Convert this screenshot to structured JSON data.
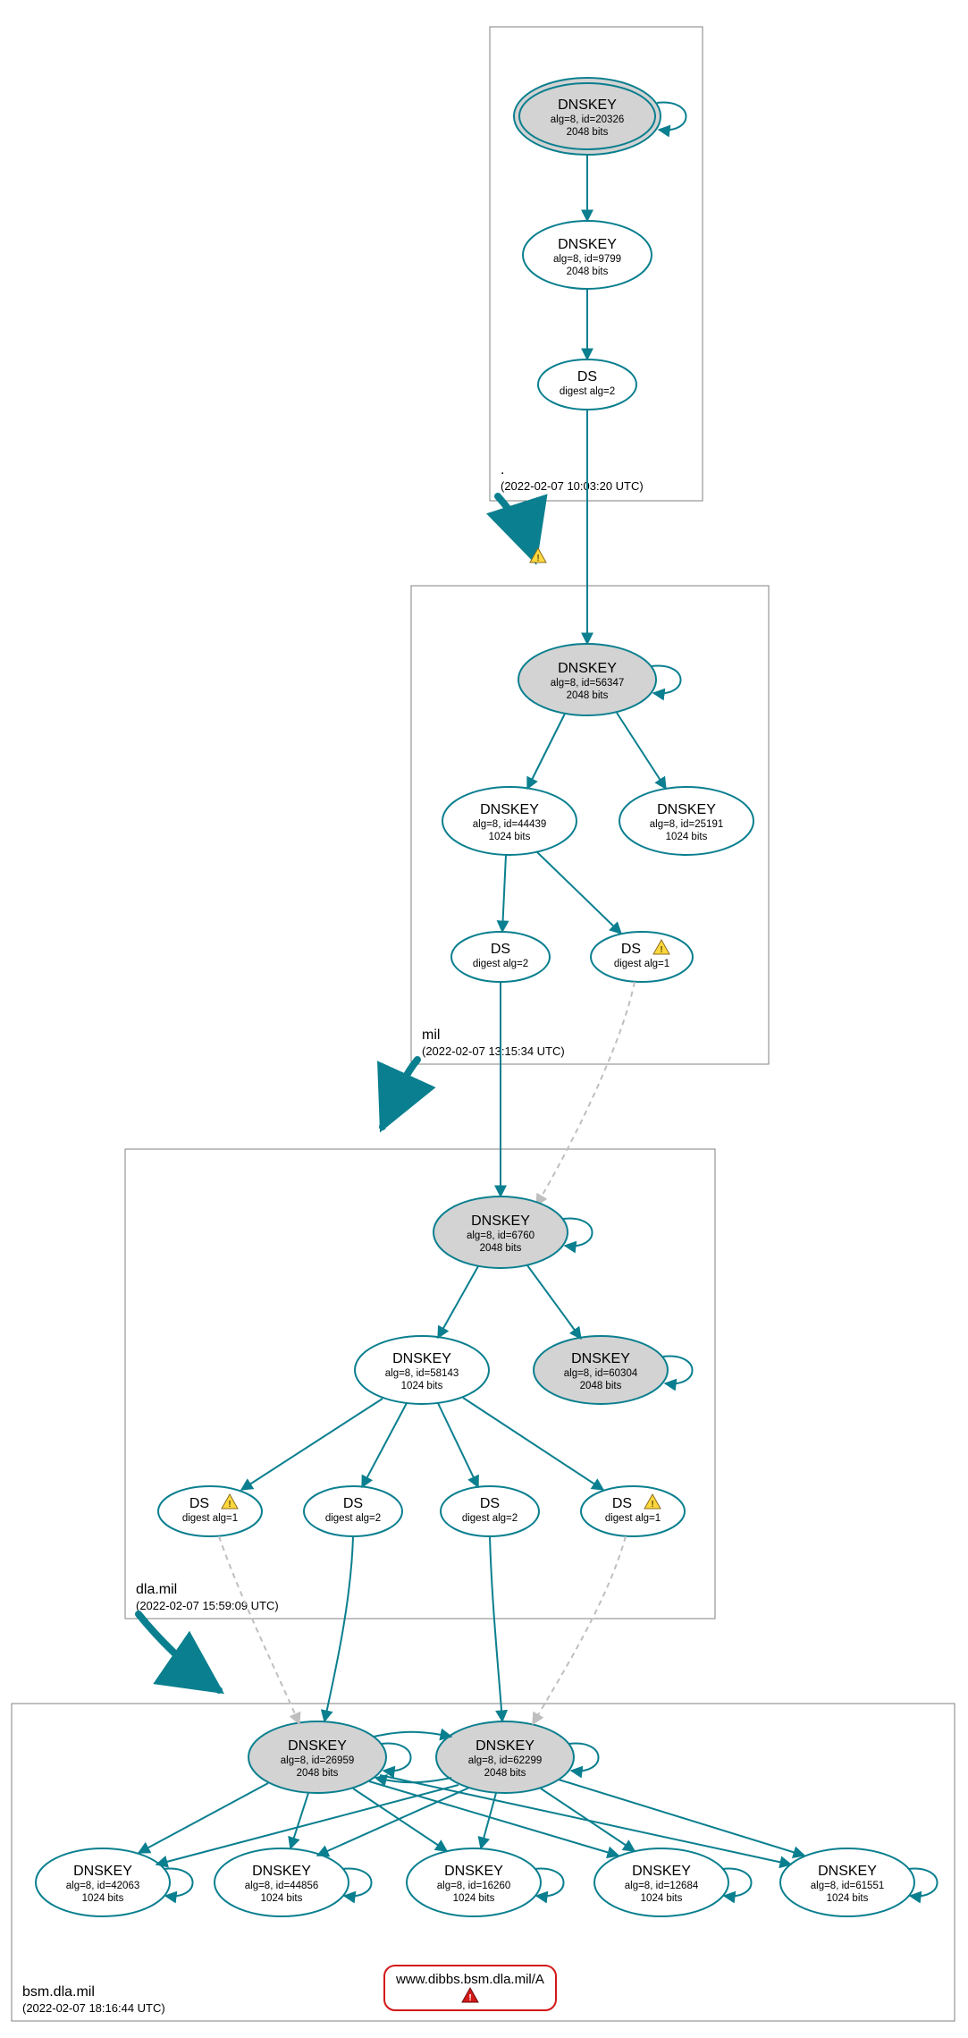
{
  "chart_data": {
    "type": "graph",
    "zones": [
      {
        "id": "root",
        "name": ".",
        "timestamp": "(2022-02-07 10:03:20 UTC)"
      },
      {
        "id": "mil",
        "name": "mil",
        "timestamp": "(2022-02-07 13:15:34 UTC)"
      },
      {
        "id": "dla",
        "name": "dla.mil",
        "timestamp": "(2022-02-07 15:59:09 UTC)"
      },
      {
        "id": "bsm",
        "name": "bsm.dla.mil",
        "timestamp": "(2022-02-07 18:16:44 UTC)"
      }
    ],
    "nodes": {
      "root_ksk": {
        "title": "DNSKEY",
        "line2": "alg=8, id=20326",
        "line3": "2048 bits"
      },
      "root_zsk": {
        "title": "DNSKEY",
        "line2": "alg=8, id=9799",
        "line3": "2048 bits"
      },
      "root_ds": {
        "title": "DS",
        "line2": "digest alg=2"
      },
      "mil_ksk": {
        "title": "DNSKEY",
        "line2": "alg=8, id=56347",
        "line3": "2048 bits"
      },
      "mil_zsk_l": {
        "title": "DNSKEY",
        "line2": "alg=8, id=44439",
        "line3": "1024 bits"
      },
      "mil_zsk_r": {
        "title": "DNSKEY",
        "line2": "alg=8, id=25191",
        "line3": "1024 bits"
      },
      "mil_ds_l": {
        "title": "DS",
        "line2": "digest alg=2"
      },
      "mil_ds_r": {
        "title": "DS",
        "line2": "digest alg=1"
      },
      "dla_ksk": {
        "title": "DNSKEY",
        "line2": "alg=8, id=6760",
        "line3": "2048 bits"
      },
      "dla_zsk": {
        "title": "DNSKEY",
        "line2": "alg=8, id=58143",
        "line3": "1024 bits"
      },
      "dla_ksk2": {
        "title": "DNSKEY",
        "line2": "alg=8, id=60304",
        "line3": "2048 bits"
      },
      "dla_ds1": {
        "title": "DS",
        "line2": "digest alg=1"
      },
      "dla_ds2": {
        "title": "DS",
        "line2": "digest alg=2"
      },
      "dla_ds3": {
        "title": "DS",
        "line2": "digest alg=2"
      },
      "dla_ds4": {
        "title": "DS",
        "line2": "digest alg=1"
      },
      "bsm_ksk_l": {
        "title": "DNSKEY",
        "line2": "alg=8, id=26959",
        "line3": "2048 bits"
      },
      "bsm_ksk_r": {
        "title": "DNSKEY",
        "line2": "alg=8, id=62299",
        "line3": "2048 bits"
      },
      "bsm_z1": {
        "title": "DNSKEY",
        "line2": "alg=8, id=42063",
        "line3": "1024 bits"
      },
      "bsm_z2": {
        "title": "DNSKEY",
        "line2": "alg=8, id=44856",
        "line3": "1024 bits"
      },
      "bsm_z3": {
        "title": "DNSKEY",
        "line2": "alg=8, id=16260",
        "line3": "1024 bits"
      },
      "bsm_z4": {
        "title": "DNSKEY",
        "line2": "alg=8, id=12684",
        "line3": "1024 bits"
      },
      "bsm_z5": {
        "title": "DNSKEY",
        "line2": "alg=8, id=61551",
        "line3": "1024 bits"
      },
      "rr": {
        "title": "www.dibbs.bsm.dla.mil/A"
      }
    }
  }
}
